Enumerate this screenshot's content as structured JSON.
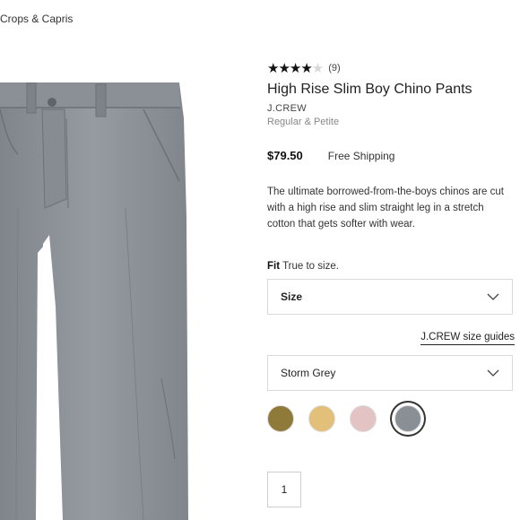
{
  "breadcrumb": {
    "label": "Crops & Capris"
  },
  "product": {
    "rating_stars": {
      "full": "★★★★",
      "empty": "★"
    },
    "rating_count": "(9)",
    "title": "High Rise Slim Boy Chino Pants",
    "brand": "J.CREW",
    "sizes_note": "Regular & Petite",
    "price": "$79.50",
    "shipping": "Free Shipping",
    "description": "The ultimate borrowed-from-the-boys chinos are cut with a high rise and slim straight leg in a stretch cotton that gets softer with wear.",
    "fit_label": "Fit",
    "fit_value": "True to size.",
    "size_select": "Size",
    "size_guide": "J.CREW size guides",
    "color_select": "Storm Grey",
    "quantity": "1"
  },
  "swatches": [
    {
      "name": "olive",
      "color": "#8f7a3a"
    },
    {
      "name": "tan",
      "color": "#e2c07a"
    },
    {
      "name": "pink",
      "color": "#e3c3c3"
    },
    {
      "name": "storm-grey",
      "color": "#8a8f96",
      "selected": true
    }
  ],
  "colors": {
    "pants": "#8d9399",
    "pants_dark": "#6c7177"
  }
}
